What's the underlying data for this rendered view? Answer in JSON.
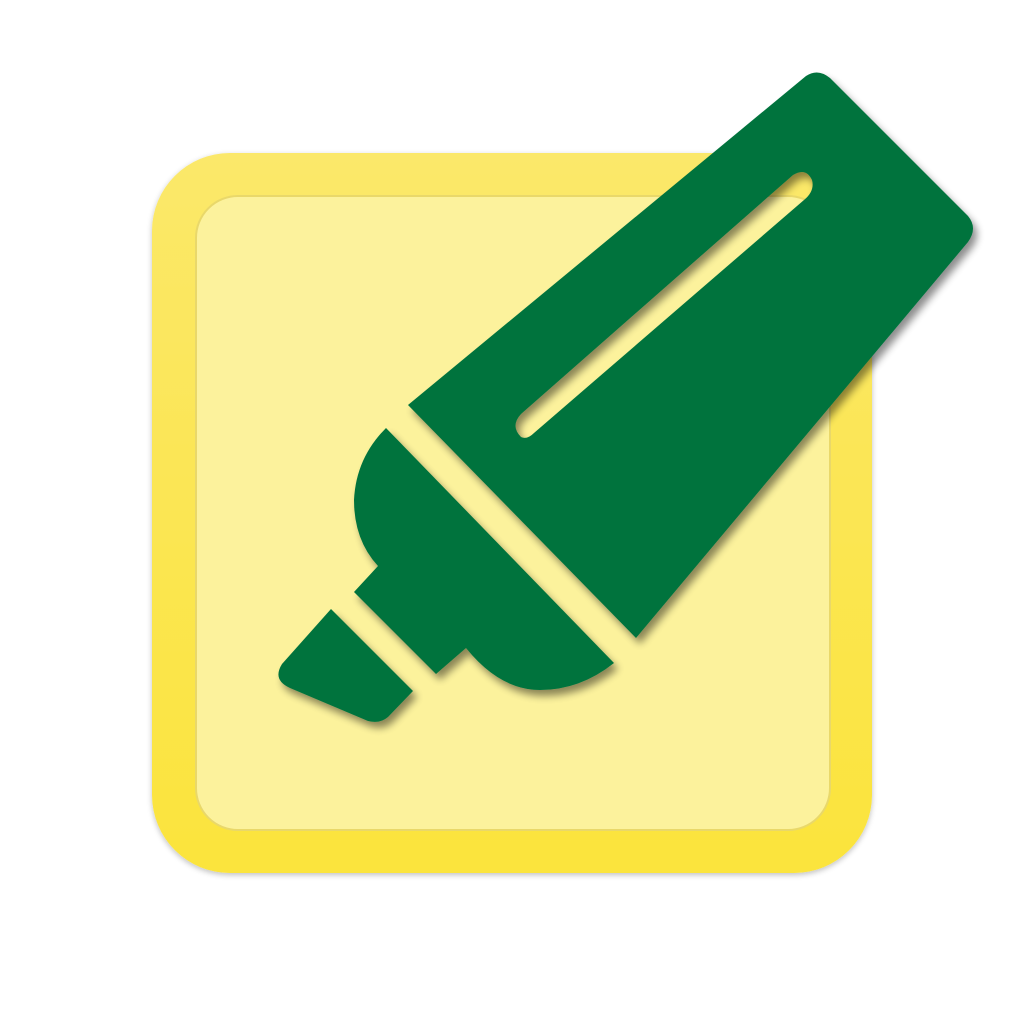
{
  "icon": {
    "name": "highlighter-note-icon",
    "colors": {
      "background": "#ffffff",
      "frame_outer": "#fbe64a",
      "frame_inner_fill": "#fcf29c",
      "marker": "#03733d"
    }
  }
}
